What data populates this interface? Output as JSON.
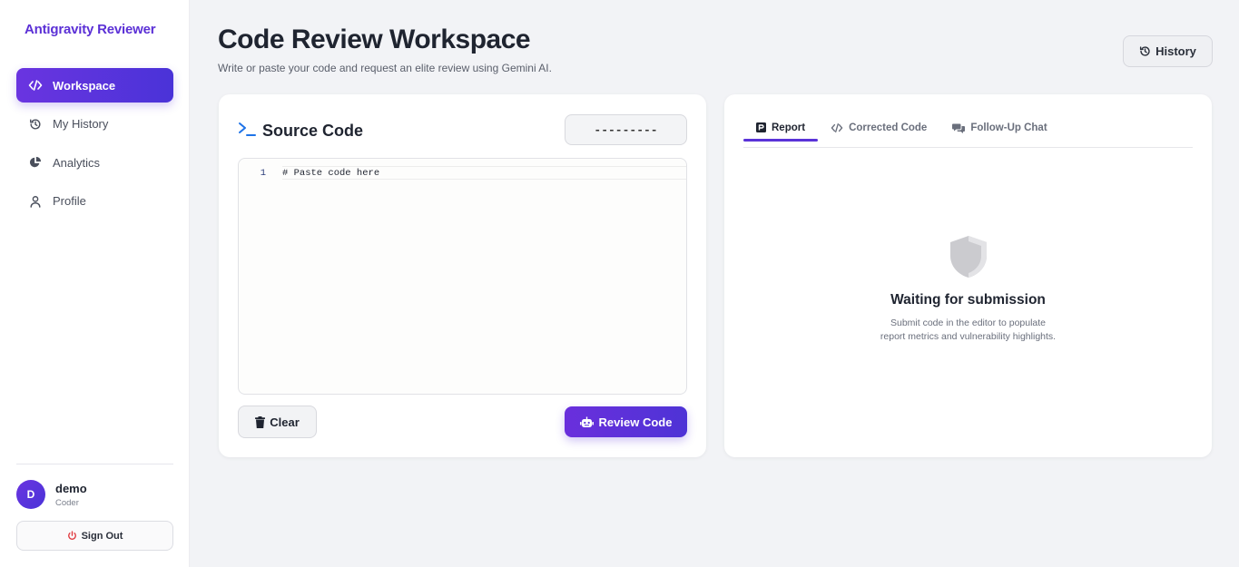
{
  "sidebar": {
    "brand": "Antigravity Reviewer",
    "items": [
      {
        "label": "Workspace",
        "icon": "code-icon",
        "active": true
      },
      {
        "label": "My History",
        "icon": "history-icon",
        "active": false
      },
      {
        "label": "Analytics",
        "icon": "pie-chart-icon",
        "active": false
      },
      {
        "label": "Profile",
        "icon": "user-icon",
        "active": false
      }
    ],
    "user": {
      "initial": "D",
      "name": "demo",
      "role": "Coder"
    },
    "signout_label": "Sign Out"
  },
  "header": {
    "title": "Code Review Workspace",
    "subtitle": "Write or paste your code and request an elite review using Gemini AI.",
    "history_label": "History"
  },
  "editor_panel": {
    "title": "Source Code",
    "language_value": "---------",
    "line_number": "1",
    "code_placeholder": "# Paste code here",
    "clear_label": "Clear",
    "review_label": "Review Code"
  },
  "results_panel": {
    "tabs": [
      {
        "label": "Report",
        "icon": "report-icon",
        "active": true
      },
      {
        "label": "Corrected Code",
        "icon": "code-icon",
        "active": false
      },
      {
        "label": "Follow-Up Chat",
        "icon": "chat-icon",
        "active": false
      }
    ],
    "empty_title": "Waiting for submission",
    "empty_desc": "Submit code in the editor to populate report metrics and vulnerability highlights."
  },
  "colors": {
    "accent": "#5b30d6",
    "background": "#f2f3f6",
    "danger": "#e0393e",
    "terminal_blue": "#1e73e8"
  }
}
